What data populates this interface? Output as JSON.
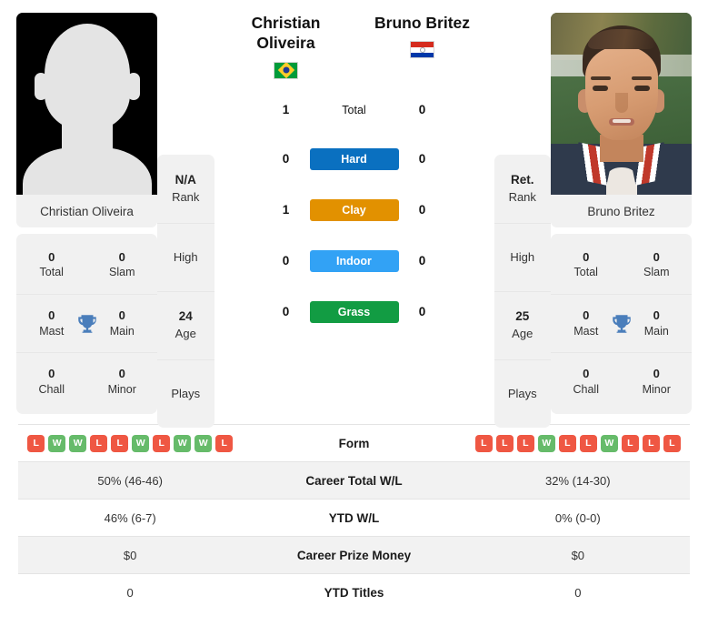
{
  "players": {
    "left": {
      "name_line1": "Christian",
      "name_line2": "Oliveira",
      "full_name": "Christian Oliveira",
      "flag": "brazil-flag",
      "photo": "placeholder-silhouette",
      "info": {
        "rank_value": "N/A",
        "rank_label": "Rank",
        "high_label": "High",
        "high_value": "",
        "age_value": "24",
        "age_label": "Age",
        "plays_label": "Plays",
        "plays_value": ""
      },
      "titles": {
        "total_value": "0",
        "total_label": "Total",
        "slam_value": "0",
        "slam_label": "Slam",
        "mast_value": "0",
        "mast_label": "Mast",
        "main_value": "0",
        "main_label": "Main",
        "chall_value": "0",
        "chall_label": "Chall",
        "minor_value": "0",
        "minor_label": "Minor",
        "trophy_icon": "trophy-icon"
      },
      "form": [
        "L",
        "W",
        "W",
        "L",
        "L",
        "W",
        "L",
        "W",
        "W",
        "L"
      ],
      "career_total_wl": "50% (46-46)",
      "ytd_wl": "46% (6-7)",
      "career_prize_money": "$0",
      "ytd_titles": "0"
    },
    "right": {
      "name_line1": "Bruno Britez",
      "name_line2": "",
      "full_name": "Bruno Britez",
      "flag": "paraguay-flag",
      "photo": "player-portrait",
      "info": {
        "rank_value": "Ret.",
        "rank_label": "Rank",
        "high_label": "High",
        "high_value": "",
        "age_value": "25",
        "age_label": "Age",
        "plays_label": "Plays",
        "plays_value": ""
      },
      "titles": {
        "total_value": "0",
        "total_label": "Total",
        "slam_value": "0",
        "slam_label": "Slam",
        "mast_value": "0",
        "mast_label": "Mast",
        "main_value": "0",
        "main_label": "Main",
        "chall_value": "0",
        "chall_label": "Chall",
        "minor_value": "0",
        "minor_label": "Minor",
        "trophy_icon": "trophy-icon"
      },
      "form": [
        "L",
        "L",
        "L",
        "W",
        "L",
        "L",
        "W",
        "L",
        "L",
        "L"
      ],
      "career_total_wl": "32% (14-30)",
      "ytd_wl": "0% (0-0)",
      "career_prize_money": "$0",
      "ytd_titles": "0"
    }
  },
  "head_to_head": {
    "rows": [
      {
        "label": "Total",
        "left": "1",
        "right": "0",
        "color": "",
        "style": "plain"
      },
      {
        "label": "Hard",
        "left": "0",
        "right": "0",
        "color": "#0a70c0",
        "style": "badge"
      },
      {
        "label": "Clay",
        "left": "1",
        "right": "0",
        "color": "#e29100",
        "style": "badge"
      },
      {
        "label": "Indoor",
        "left": "0",
        "right": "0",
        "color": "#32a2f5",
        "style": "badge"
      },
      {
        "label": "Grass",
        "left": "0",
        "right": "0",
        "color": "#129c43",
        "style": "badge"
      }
    ]
  },
  "stats_table": {
    "rows": [
      {
        "label": "Form",
        "left": "",
        "right": "",
        "type": "form"
      },
      {
        "label": "Career Total W/L",
        "left": "50% (46-46)",
        "right": "32% (14-30)",
        "type": "text"
      },
      {
        "label": "YTD W/L",
        "left": "46% (6-7)",
        "right": "0% (0-0)",
        "type": "text"
      },
      {
        "label": "Career Prize Money",
        "left": "$0",
        "right": "$0",
        "type": "text"
      },
      {
        "label": "YTD Titles",
        "left": "0",
        "right": "0",
        "type": "text"
      }
    ]
  },
  "colors": {
    "hard": "#0a70c0",
    "clay": "#e29100",
    "indoor": "#32a2f5",
    "grass": "#129c43",
    "win": "#66bb6a",
    "loss": "#ef5743",
    "card_bg": "#f1f1f1",
    "row_shade": "#f2f2f2",
    "trophy": "#4a7ebb"
  }
}
